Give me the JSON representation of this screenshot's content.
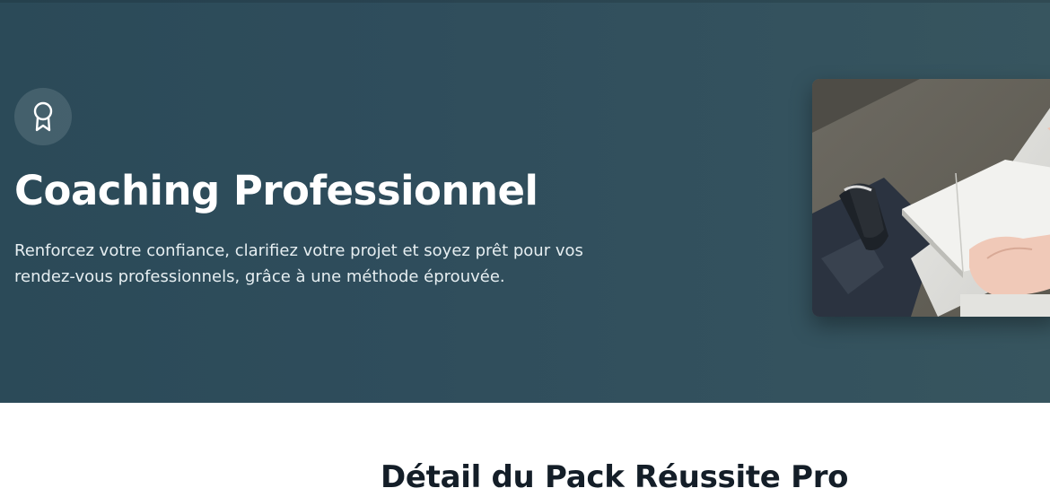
{
  "hero": {
    "title": "Coaching Professionnel",
    "subtitle": "Renforcez votre confiance, clarifiez votre projet et soyez prêt pour vos rendez-vous professionnels, grâce à une méthode éprouvée.",
    "icon": "award-ribbon-icon",
    "colors": {
      "background": "#2f4d5c",
      "text": "#ffffff"
    }
  },
  "section": {
    "title": "Détail du Pack Réussite Pro"
  }
}
